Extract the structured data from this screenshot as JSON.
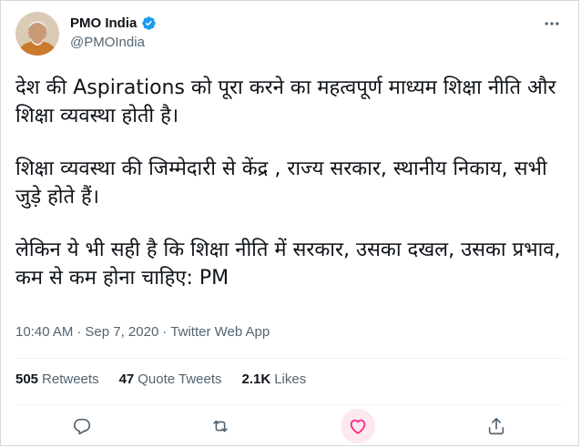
{
  "author": {
    "display_name": "PMO India",
    "handle": "@PMOIndia",
    "verified": true
  },
  "tweet": {
    "paragraphs": [
      "देश की Aspirations को पूरा करने का महत्वपूर्ण माध्यम शिक्षा नीति और शिक्षा व्यवस्था होती है।",
      "शिक्षा व्यवस्था की जिम्मेदारी से केंद्र , राज्य सरकार, स्थानीय निकाय, सभी जुड़े होते हैं।",
      "लेकिन ये भी सही है कि शिक्षा नीति में सरकार, उसका दखल, उसका प्रभाव, कम से कम होना चाहिए: PM"
    ],
    "time": "10:40 AM",
    "separator1": "·",
    "date": "Sep 7, 2020",
    "separator2": "·",
    "source": "Twitter Web App"
  },
  "stats": {
    "retweets_count": "505",
    "retweets_label": "Retweets",
    "quotes_count": "47",
    "quotes_label": "Quote Tweets",
    "likes_count": "2.1K",
    "likes_label": "Likes"
  },
  "colors": {
    "text": "#0f1419",
    "secondary": "#536471",
    "verified": "#1d9bf0",
    "like_accent": "#f91880",
    "border": "#cfd9de"
  },
  "icons": {
    "more": "more-horizontal-icon",
    "reply": "reply-icon",
    "retweet": "retweet-icon",
    "like": "heart-icon",
    "share": "share-icon",
    "verified": "verified-badge-icon"
  }
}
